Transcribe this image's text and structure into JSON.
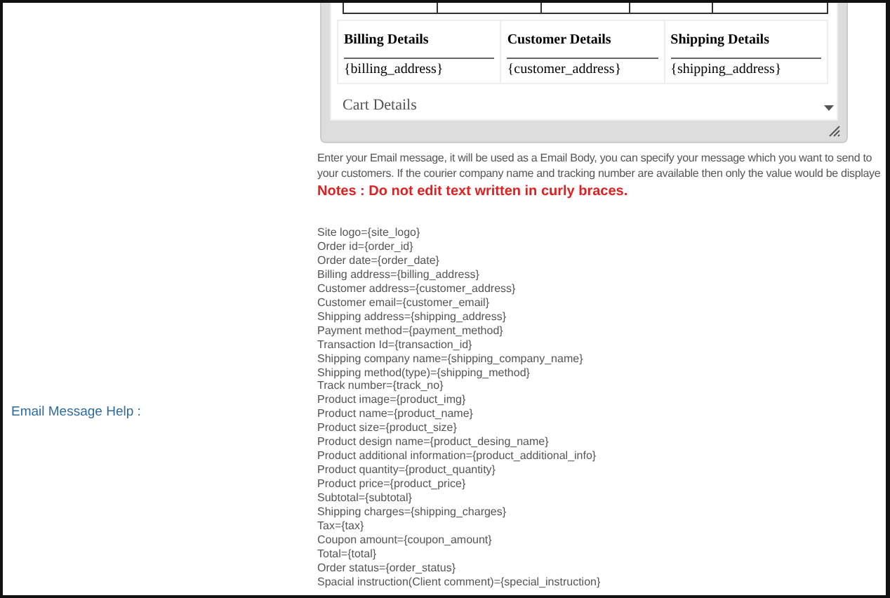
{
  "editor": {
    "details_table": {
      "columns": [
        {
          "heading": "Billing Details",
          "value": "{billing_address}"
        },
        {
          "heading": "Customer Details",
          "value": "{customer_address}"
        },
        {
          "heading": "Shipping Details",
          "value": "{shipping_address}"
        }
      ],
      "next_section": "Cart Details"
    }
  },
  "description": [
    "Enter your Email message, it will be used as a Email Body, you can specify your message which you want to send to",
    "your customers. If the courier company name and tracking number are available then only the value would be displaye"
  ],
  "note": "Notes : Do not edit text written in curly braces.",
  "help_label": "Email Message Help :",
  "placeholders": [
    "Site logo={site_logo}",
    "Order id={order_id}",
    "Order date={order_date}",
    "Billing address={billing_address}",
    "Customer address={customer_address}",
    "Customer email={customer_email}",
    "Shipping address={shipping_address}",
    "Payment method={payment_method}",
    "Transaction Id={transaction_id}",
    "Shipping company name={shipping_company_name}",
    "Shipping method(type)={shipping_method}",
    "Track number={track_no}",
    "Product image={product_img}",
    "Product name={product_name}",
    "Product size={product_size}",
    "Product design name={product_desing_name}",
    "Product additional information={product_additional_info}",
    "Product quantity={product_quantity}",
    "Product price={product_price}",
    "Subtotal={subtotal}",
    "Shipping charges={shipping_charges}",
    "Tax={tax}",
    "Coupon amount={coupon_amount}",
    "Total={total}",
    "Order status={order_status}",
    "Spacial instruction(Client comment)={special_instruction}"
  ]
}
